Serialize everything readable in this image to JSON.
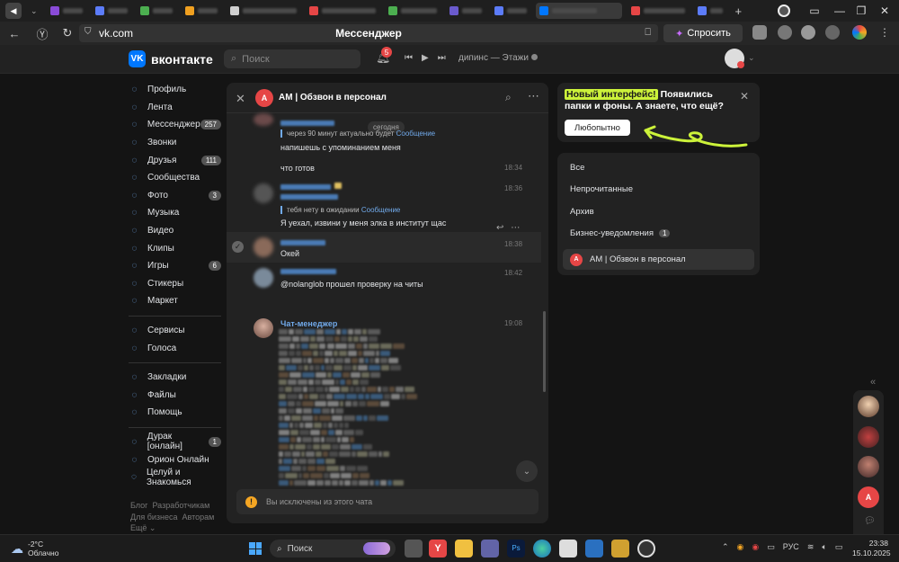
{
  "browser": {
    "url": "vk.com",
    "page_title": "Мессенджер",
    "ask_button": "Спросить"
  },
  "header": {
    "logo_text": "вконтакте",
    "logo_mark": "VK",
    "search_placeholder": "Поиск",
    "notifications_count": "5",
    "track": "дипинс — Этажи"
  },
  "nav": {
    "items": [
      {
        "label": "Профиль",
        "icon": "profile-icon",
        "count": ""
      },
      {
        "label": "Лента",
        "icon": "feed-icon",
        "count": ""
      },
      {
        "label": "Мессенджер",
        "icon": "messenger-icon",
        "count": "257"
      },
      {
        "label": "Звонки",
        "icon": "phone-icon",
        "count": ""
      },
      {
        "label": "Друзья",
        "icon": "friends-icon",
        "count": "111"
      },
      {
        "label": "Сообщества",
        "icon": "communities-icon",
        "count": ""
      },
      {
        "label": "Фото",
        "icon": "photo-icon",
        "count": "3"
      },
      {
        "label": "Музыка",
        "icon": "music-icon",
        "count": ""
      },
      {
        "label": "Видео",
        "icon": "video-icon",
        "count": ""
      },
      {
        "label": "Клипы",
        "icon": "clips-icon",
        "count": ""
      },
      {
        "label": "Игры",
        "icon": "games-icon",
        "count": "6"
      },
      {
        "label": "Стикеры",
        "icon": "stickers-icon",
        "count": ""
      },
      {
        "label": "Маркет",
        "icon": "market-icon",
        "count": ""
      }
    ],
    "items2": [
      {
        "label": "Сервисы",
        "icon": "services-icon",
        "count": ""
      },
      {
        "label": "Голоса",
        "icon": "votes-icon",
        "count": ""
      }
    ],
    "items3": [
      {
        "label": "Закладки",
        "icon": "bookmark-icon",
        "count": ""
      },
      {
        "label": "Файлы",
        "icon": "files-icon",
        "count": ""
      },
      {
        "label": "Помощь",
        "icon": "help-icon",
        "count": ""
      }
    ],
    "items4": [
      {
        "label": "Дурак [онлайн]",
        "icon": "game-icon",
        "count": "1"
      },
      {
        "label": "Орион Онлайн",
        "icon": "game-icon",
        "count": ""
      },
      {
        "label": "Целуй и Знакомься",
        "icon": "game-icon",
        "count": ""
      }
    ],
    "footer": [
      "Блог",
      "Разработчикам",
      "Для бизнеса",
      "Авторам",
      "Ещё ⌄"
    ]
  },
  "chat": {
    "title": "AM | Обзвон в персонал",
    "avatar_letter": "A",
    "date_divider": "сегодня",
    "messages": [
      {
        "reply_text": "через 90 минут актуально будет",
        "reply_link": "Сообщение",
        "text": "напишешь с упоминанием меня",
        "time": ""
      },
      {
        "text": "что готов",
        "time": "18:34"
      },
      {
        "reply_text": "тебя нету в ожидании",
        "reply_link": "Сообщение",
        "text": "Я уехал, извини у меня элка в институт щас",
        "time": "18:36"
      },
      {
        "text": "Окей",
        "time": "18:38"
      },
      {
        "text": "@nolanglob прошел проверку на читы",
        "time": "18:42"
      },
      {
        "author": "Чат-менеджер",
        "time": "19:08"
      }
    ],
    "excluded_notice": "Вы исключены из этого чата"
  },
  "promo": {
    "highlight": "Новый интерфейс!",
    "text": " Появились папки и фоны. А знаете, что ещё?",
    "button": "Любопытно"
  },
  "folders": [
    {
      "label": "Все",
      "count": ""
    },
    {
      "label": "Непрочитанные",
      "count": ""
    },
    {
      "label": "Архив",
      "count": ""
    },
    {
      "label": "Бизнес-уведомления",
      "count": "1"
    },
    {
      "label": "AM | Обзвон в персонал",
      "count": ""
    }
  ],
  "taskbar": {
    "temperature": "-2°C",
    "weather": "Облачно",
    "search": "Поиск",
    "lang": "РУС",
    "time": "23:38",
    "date": "15.10.2025"
  },
  "colors": {
    "accent": "#0077ff",
    "link": "#71aaeb",
    "highlight": "#ccf23a",
    "danger": "#e64646"
  }
}
